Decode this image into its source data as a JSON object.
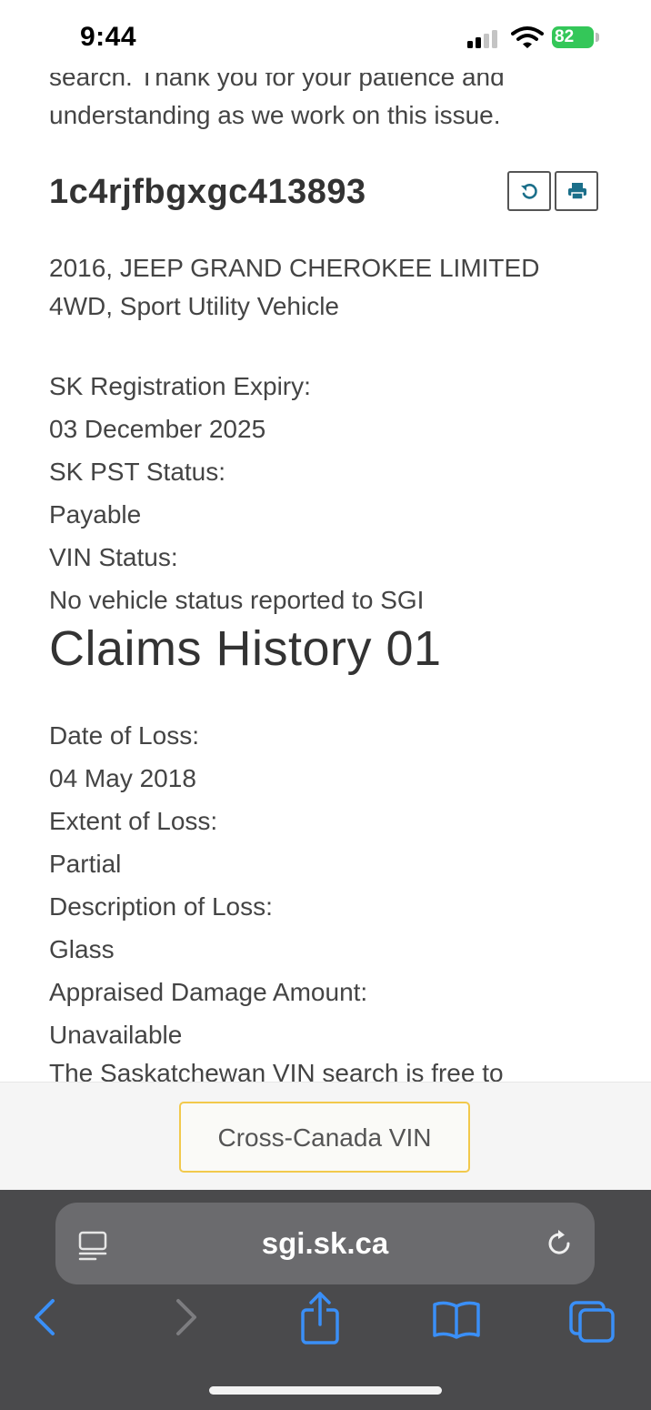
{
  "status_bar": {
    "time": "9:44",
    "battery": "82"
  },
  "page": {
    "intro_text": "search. Thank you for your patience and understanding as we work on this issue.",
    "vin": "1c4rjfbgxgc413893",
    "vehicle_description": "2016, JEEP GRAND CHEROKEE LIMITED 4WD, Sport Utility Vehicle",
    "fields": [
      {
        "label": "SK Registration Expiry:",
        "value": "03 December 2025"
      },
      {
        "label": "SK PST Status:",
        "value": "Payable"
      },
      {
        "label": "VIN Status:",
        "value": "No vehicle status reported to SGI"
      }
    ],
    "claims_heading": "Claims History 01",
    "claims": [
      {
        "label": "Date of Loss:",
        "value": "04 May 2018"
      },
      {
        "label": "Extent of Loss:",
        "value": "Partial"
      },
      {
        "label": "Description of Loss:",
        "value": "Glass"
      },
      {
        "label": "Appraised Damage Amount:",
        "value": "Unavailable"
      }
    ],
    "footer_text": "The Saskatchewan VIN search is free to"
  },
  "sticky": {
    "cross_canada_label": "Cross-Canada VIN"
  },
  "browser": {
    "url": "sgi.sk.ca"
  },
  "icons": {
    "reset": "reset-icon",
    "print": "print-icon",
    "page_menu": "page-menu-icon",
    "reload": "reload-icon",
    "back": "back-chevron-icon",
    "forward": "forward-chevron-icon",
    "share": "share-icon",
    "bookmarks": "bookmarks-icon",
    "tabs": "tabs-icon"
  },
  "colors": {
    "accent_teal": "#1b6f8a",
    "safari_blue": "#3a8ff7",
    "button_border_yellow": "#f2c94c",
    "battery_green": "#34c759"
  }
}
